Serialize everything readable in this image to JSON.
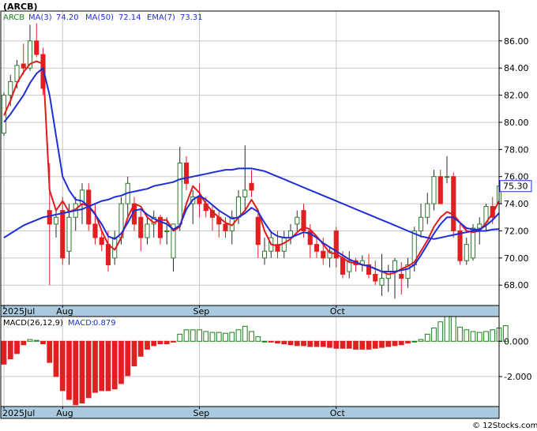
{
  "title": "(ARCB)",
  "copyright": "© 12Stocks.com",
  "colors": {
    "bg": "#ffffff",
    "grid": "#c8c8c8",
    "axis_band": "#a9c9df",
    "frame": "#000000",
    "up": "#1a7f1a",
    "down": "#e02020",
    "ma3": "#e31a1c",
    "ma50": "#1f2ed6",
    "ema7": "#1f2ed6",
    "macd_bar_pos": "#1a7f1a",
    "macd_bar_neg": "#e02020",
    "price_tag": "#ffffff",
    "price_tag_border": "#1f2ed6"
  },
  "legend": {
    "ticker": "ARCB",
    "ma3_label": "MA(3)",
    "ma3_value": "74.20",
    "ma50_label": "MA(50)",
    "ma50_value": "72.14",
    "ema7_label": "EMA(7)",
    "ema7_value": "73.31"
  },
  "macd_legend": {
    "label": "MACD(26,12,9)",
    "value_label": "MACD:",
    "value": "0.879"
  },
  "last_price": "75.30",
  "chart_data": [
    {
      "type": "candlestick",
      "ylim": [
        66.5,
        88.2
      ],
      "yticks": [
        68,
        70,
        72,
        74,
        76,
        78,
        80,
        82,
        84,
        86
      ],
      "ytick_labels": [
        "68.00",
        "70.00",
        "72.00",
        "74.00",
        "76.00",
        "78.00",
        "80.00",
        "82.00",
        "84.00",
        "86.00"
      ],
      "xticks": [
        {
          "index": 0,
          "label": "2025Jul"
        },
        {
          "index": 9,
          "label": "Aug"
        },
        {
          "index": 30,
          "label": "Sep"
        },
        {
          "index": 51,
          "label": "Oct"
        }
      ],
      "ohlc": [
        [
          79.2,
          82.2,
          79.0,
          82.0
        ],
        [
          82.0,
          83.5,
          81.2,
          83.0
        ],
        [
          83.0,
          84.6,
          82.5,
          84.2
        ],
        [
          84.3,
          85.8,
          83.5,
          84.0
        ],
        [
          84.0,
          87.2,
          83.8,
          86.0
        ],
        [
          86.0,
          87.3,
          84.8,
          85.0
        ],
        [
          85.0,
          85.5,
          82.0,
          82.5
        ],
        [
          73.5,
          77.0,
          68.0,
          72.5
        ],
        [
          72.5,
          73.5,
          71.5,
          73.0
        ],
        [
          73.5,
          74.5,
          69.5,
          70.0
        ],
        [
          70.5,
          74.0,
          69.5,
          73.0
        ],
        [
          73.0,
          74.5,
          72.0,
          74.0
        ],
        [
          74.0,
          75.5,
          72.5,
          75.0
        ],
        [
          75.0,
          75.5,
          72.0,
          72.5
        ],
        [
          72.5,
          74.0,
          71.0,
          71.5
        ],
        [
          71.5,
          72.0,
          70.5,
          71.0
        ],
        [
          71.0,
          72.0,
          69.0,
          69.5
        ],
        [
          70.0,
          72.0,
          69.5,
          71.5
        ],
        [
          71.5,
          74.5,
          71.0,
          74.0
        ],
        [
          74.0,
          76.0,
          73.0,
          75.5
        ],
        [
          74.0,
          74.5,
          72.0,
          72.5
        ],
        [
          73.0,
          73.5,
          70.5,
          71.5
        ],
        [
          71.5,
          73.0,
          71.0,
          72.5
        ],
        [
          72.5,
          73.5,
          71.5,
          73.0
        ],
        [
          73.0,
          73.2,
          71.0,
          71.5
        ],
        [
          72.0,
          73.0,
          71.0,
          72.0
        ],
        [
          70.0,
          72.5,
          69.0,
          72.5
        ],
        [
          72.5,
          78.2,
          72.0,
          77.0
        ],
        [
          77.0,
          77.5,
          75.0,
          75.5
        ],
        [
          74.0,
          75.0,
          72.5,
          74.5
        ],
        [
          74.5,
          75.5,
          73.0,
          74.0
        ],
        [
          74.0,
          74.5,
          73.0,
          73.5
        ],
        [
          73.5,
          73.8,
          72.0,
          73.0
        ],
        [
          73.0,
          73.5,
          71.5,
          72.5
        ],
        [
          72.5,
          73.0,
          71.5,
          72.0
        ],
        [
          72.0,
          73.5,
          71.0,
          73.0
        ],
        [
          73.0,
          75.0,
          72.5,
          74.5
        ],
        [
          74.5,
          78.3,
          73.5,
          75.0
        ],
        [
          75.5,
          76.5,
          74.5,
          75.0
        ],
        [
          73.0,
          73.5,
          70.0,
          71.0
        ],
        [
          70.0,
          71.5,
          69.5,
          70.5
        ],
        [
          70.5,
          72.0,
          70.0,
          71.5
        ],
        [
          71.0,
          72.0,
          70.0,
          70.5
        ],
        [
          70.5,
          72.0,
          70.0,
          71.5
        ],
        [
          71.5,
          72.5,
          71.0,
          72.0
        ],
        [
          72.5,
          73.5,
          72.0,
          73.0
        ],
        [
          73.5,
          74.0,
          71.5,
          72.0
        ],
        [
          72.0,
          72.5,
          70.0,
          71.0
        ],
        [
          71.0,
          71.5,
          70.0,
          70.5
        ],
        [
          70.5,
          71.5,
          69.5,
          70.0
        ],
        [
          70.0,
          70.8,
          69.3,
          70.5
        ],
        [
          72.0,
          72.3,
          69.3,
          70.0
        ],
        [
          70.0,
          70.5,
          68.5,
          68.8
        ],
        [
          69.0,
          70.5,
          68.5,
          69.8
        ],
        [
          69.8,
          70.0,
          69.0,
          69.5
        ],
        [
          69.5,
          70.2,
          69.0,
          69.8
        ],
        [
          69.5,
          70.3,
          68.5,
          68.8
        ],
        [
          68.8,
          69.8,
          68.0,
          68.3
        ],
        [
          68.0,
          70.3,
          67.2,
          68.5
        ],
        [
          68.5,
          69.5,
          67.5,
          69.0
        ],
        [
          69.0,
          70.0,
          67.0,
          69.8
        ],
        [
          68.8,
          69.7,
          67.3,
          68.5
        ],
        [
          68.5,
          70.0,
          67.8,
          69.5
        ],
        [
          69.5,
          72.3,
          69.0,
          72.0
        ],
        [
          72.0,
          74.0,
          71.5,
          73.0
        ],
        [
          73.0,
          74.8,
          72.5,
          74.0
        ],
        [
          74.0,
          76.5,
          73.5,
          76.0
        ],
        [
          76.0,
          76.5,
          74.0,
          74.0
        ],
        [
          76.0,
          77.5,
          75.5,
          76.0
        ],
        [
          76.0,
          76.3,
          71.5,
          72.0
        ],
        [
          72.0,
          72.5,
          69.5,
          69.8
        ],
        [
          69.8,
          71.5,
          69.5,
          71.0
        ],
        [
          70.0,
          72.5,
          69.8,
          72.2
        ],
        [
          72.2,
          73.0,
          71.0,
          72.5
        ],
        [
          72.5,
          74.0,
          72.0,
          73.8
        ],
        [
          73.8,
          74.5,
          72.5,
          73.0
        ],
        [
          74.0,
          75.8,
          73.8,
          75.3
        ]
      ],
      "series": [
        {
          "name": "MA(3)",
          "values": [
            80.5,
            81.6,
            82.9,
            83.7,
            84.3,
            84.5,
            84.3,
            75.0,
            73.5,
            74.2,
            73.4,
            73.6,
            74.0,
            73.8,
            73.3,
            72.0,
            71.0,
            70.6,
            71.5,
            73.0,
            74.0,
            73.8,
            73.0,
            72.6,
            72.8,
            72.8,
            72.0,
            72.3,
            74.0,
            75.3,
            74.8,
            74.0,
            73.4,
            73.0,
            72.6,
            72.4,
            73.0,
            73.5,
            74.3,
            73.5,
            72.0,
            71.0,
            70.9,
            71.1,
            71.4,
            71.9,
            72.3,
            72.1,
            71.6,
            71.0,
            70.4,
            70.3,
            70.0,
            69.7,
            69.6,
            69.5,
            69.4,
            69.2,
            69.0,
            68.8,
            68.9,
            69.2,
            69.4,
            69.7,
            70.5,
            71.3,
            72.3,
            73.0,
            73.4,
            73.2,
            72.6,
            72.0,
            71.9,
            72.0,
            72.6,
            73.3,
            74.2
          ]
        },
        {
          "name": "MA(50)",
          "values": [
            71.5,
            71.8,
            72.1,
            72.4,
            72.6,
            72.8,
            73.0,
            73.1,
            73.2,
            73.3,
            73.4,
            73.5,
            73.6,
            73.8,
            74.0,
            74.2,
            74.3,
            74.5,
            74.6,
            74.8,
            74.9,
            75.0,
            75.1,
            75.3,
            75.4,
            75.5,
            75.6,
            75.8,
            75.9,
            76.0,
            76.1,
            76.2,
            76.3,
            76.4,
            76.5,
            76.5,
            76.6,
            76.6,
            76.6,
            76.5,
            76.4,
            76.2,
            76.0,
            75.8,
            75.6,
            75.4,
            75.2,
            75.0,
            74.8,
            74.6,
            74.4,
            74.2,
            74.0,
            73.8,
            73.6,
            73.4,
            73.2,
            73.0,
            72.8,
            72.6,
            72.4,
            72.2,
            72.0,
            71.8,
            71.6,
            71.5,
            71.4,
            71.5,
            71.6,
            71.7,
            71.8,
            71.9,
            72.0,
            72.0,
            72.0,
            72.1,
            72.14
          ]
        },
        {
          "name": "EMA(7)",
          "values": [
            80.0,
            80.6,
            81.3,
            82.0,
            82.9,
            83.6,
            84.0,
            82.0,
            79.0,
            76.0,
            75.0,
            74.3,
            74.2,
            73.8,
            73.2,
            72.5,
            71.6,
            71.4,
            71.8,
            72.6,
            73.5,
            73.6,
            73.2,
            72.9,
            72.7,
            72.5,
            72.1,
            72.4,
            73.6,
            74.3,
            74.6,
            74.3,
            73.9,
            73.5,
            73.2,
            72.9,
            73.0,
            73.3,
            73.7,
            73.4,
            72.6,
            71.9,
            71.6,
            71.5,
            71.5,
            71.7,
            71.9,
            71.8,
            71.5,
            71.1,
            70.8,
            70.5,
            70.2,
            69.9,
            69.7,
            69.5,
            69.4,
            69.2,
            69.0,
            69.0,
            69.0,
            69.1,
            69.2,
            69.5,
            70.2,
            71.0,
            71.8,
            72.5,
            73.0,
            73.0,
            72.6,
            72.2,
            72.1,
            72.1,
            72.4,
            72.8,
            73.31
          ]
        }
      ]
    },
    {
      "type": "bar",
      "title": "MACD(26,12,9)",
      "ylim": [
        -3700,
        1400
      ],
      "yticks": [
        0,
        -2000
      ],
      "ytick_labels": [
        "0.000",
        "-2.000"
      ],
      "xticks": [
        {
          "index": 0,
          "label": "2025Jul"
        },
        {
          "index": 9,
          "label": "Aug"
        },
        {
          "index": 30,
          "label": "Sep"
        },
        {
          "index": 51,
          "label": "Oct"
        }
      ],
      "values": [
        -1300,
        -1000,
        -700,
        -200,
        100,
        50,
        -150,
        -1200,
        -2000,
        -2800,
        -3300,
        -3600,
        -3500,
        -3200,
        -2900,
        -2800,
        -2800,
        -2700,
        -2400,
        -1950,
        -1400,
        -850,
        -450,
        -250,
        -150,
        -150,
        -50,
        400,
        650,
        650,
        650,
        550,
        500,
        500,
        450,
        500,
        650,
        850,
        550,
        250,
        0,
        -50,
        -100,
        -150,
        -200,
        -250,
        -250,
        -300,
        -300,
        -300,
        -350,
        -400,
        -400,
        -400,
        -450,
        -450,
        -450,
        -400,
        -350,
        -300,
        -250,
        -200,
        -100,
        0,
        100,
        400,
        750,
        1100,
        1500,
        1450,
        800,
        650,
        550,
        500,
        550,
        650,
        750,
        879
      ]
    }
  ]
}
